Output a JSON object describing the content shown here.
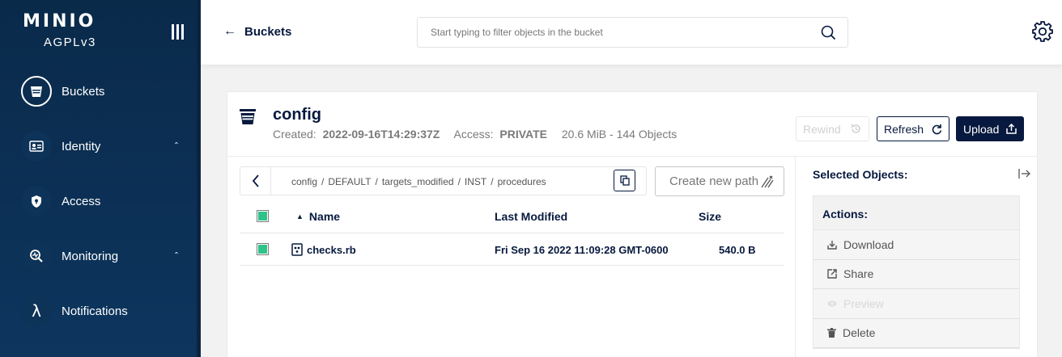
{
  "sidebar": {
    "logo": "MINIO",
    "license": "AGPLv3",
    "items": [
      {
        "label": "Buckets",
        "icon": "bucket-icon",
        "active": true
      },
      {
        "label": "Identity",
        "icon": "identity-icon",
        "expandable": true
      },
      {
        "label": "Access",
        "icon": "shield-icon"
      },
      {
        "label": "Monitoring",
        "icon": "monitoring-icon",
        "expandable": true
      },
      {
        "label": "Notifications",
        "icon": "lambda-icon"
      }
    ]
  },
  "header": {
    "back_label": "Buckets",
    "search_placeholder": "Start typing to filter objects in the bucket"
  },
  "bucket": {
    "name": "config",
    "created_label": "Created:",
    "created_value": "2022-09-16T14:29:37Z",
    "access_label": "Access:",
    "access_value": "PRIVATE",
    "usage": "20.6 MiB - 144 Objects"
  },
  "toolbar": {
    "rewind_label": "Rewind",
    "refresh_label": "Refresh",
    "upload_label": "Upload"
  },
  "breadcrumb": [
    "config",
    "DEFAULT",
    "targets_modified",
    "INST",
    "procedures"
  ],
  "breadcrumb_separator": "/",
  "new_path_label": "Create new path",
  "table": {
    "columns": {
      "name": "Name",
      "modified": "Last Modified",
      "size": "Size"
    },
    "rows": [
      {
        "name": "checks.rb",
        "modified": "Fri Sep 16 2022 11:09:28 GMT-0600",
        "size": "540.0 B",
        "selected": true
      }
    ]
  },
  "selection_panel": {
    "title": "Selected Objects:",
    "actions_title": "Actions:",
    "actions": [
      {
        "label": "Download",
        "icon": "download-icon",
        "enabled": true
      },
      {
        "label": "Share",
        "icon": "share-icon",
        "enabled": true
      },
      {
        "label": "Preview",
        "icon": "eye-icon",
        "enabled": false
      },
      {
        "label": "Delete",
        "icon": "trash-icon",
        "enabled": true
      }
    ]
  },
  "colors": {
    "sidebar_bg": "#0d355e",
    "primary": "#07193e",
    "checkbox_green": "#2ec489"
  }
}
